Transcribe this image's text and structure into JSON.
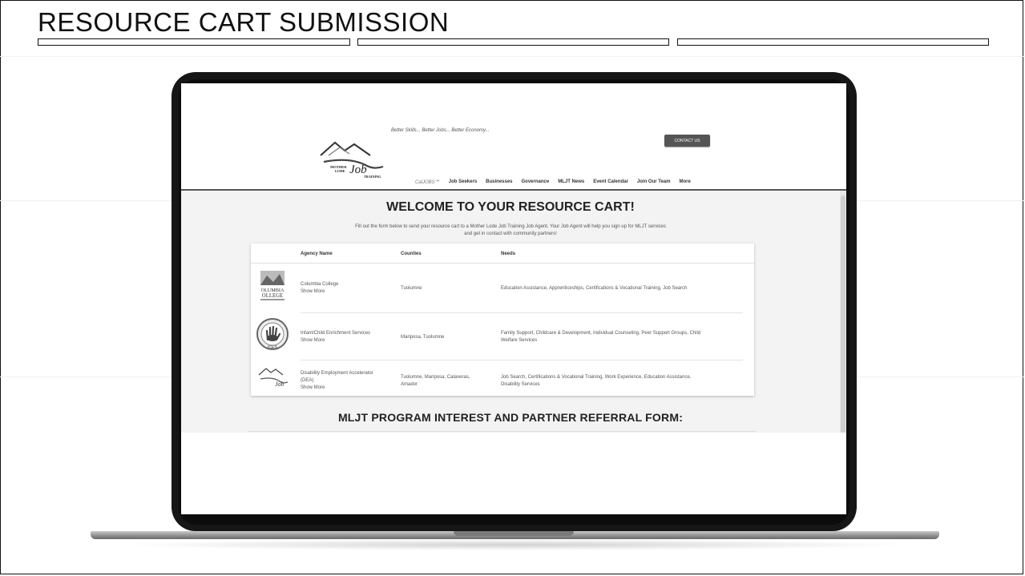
{
  "slide": {
    "title": "RESOURCE CART SUBMISSION"
  },
  "site": {
    "tagline": "Better Skills... Better Jobs... Better Economy...",
    "contact_label": "CONTACT US",
    "logo_text": "MOTHER LODE Job TRAINING",
    "nav": [
      "CalJOBS℠",
      "Job Seekers",
      "Businesses",
      "Governance",
      "MLJT News",
      "Event Calendar",
      "Join Our Team",
      "More"
    ]
  },
  "cart": {
    "heading": "WELCOME TO YOUR RESOURCE CART!",
    "intro_line1": "Fill out the form below to send your resource cart to a Mother Lode Job Training Job Agent. Your Job Agent will help you sign up for MLJT services",
    "intro_line2": "and get in contact with community partners!",
    "columns": [
      "Agency Name",
      "Counties",
      "Needs"
    ],
    "rows": [
      {
        "logo": "columbia-college-logo",
        "agency": "Columbia College",
        "show_more": "Show More",
        "counties": "Tuolumne",
        "needs": "Education Assistance, Apprenticeships, Certifications & Vocational Training, Job Search"
      },
      {
        "logo": "ices-handprint-logo",
        "agency": "Infant/Child Enrichment Services",
        "show_more": "Show More",
        "counties": "Mariposa, Tuolumne",
        "needs_line1": "Family Support, Childcare & Development, Individual Counseling, Peer Support Groups, Child",
        "needs_line2": "Welfare Services"
      },
      {
        "logo": "mother-lode-job-training-logo",
        "agency_line1": "Disability Employment Accelerator",
        "agency_line2": "(DEA)",
        "show_more": "Show More",
        "counties_line1": "Tuolumne, Mariposa, Calaveras,",
        "counties_line2": "Amador",
        "needs_line1": "Job Search, Certifications & Vocational Training, Work Experience, Education Assistance,",
        "needs_line2": "Disability Services"
      }
    ]
  },
  "form": {
    "heading": "MLJT PROGRAM INTEREST AND PARTNER REFERRAL FORM:"
  }
}
